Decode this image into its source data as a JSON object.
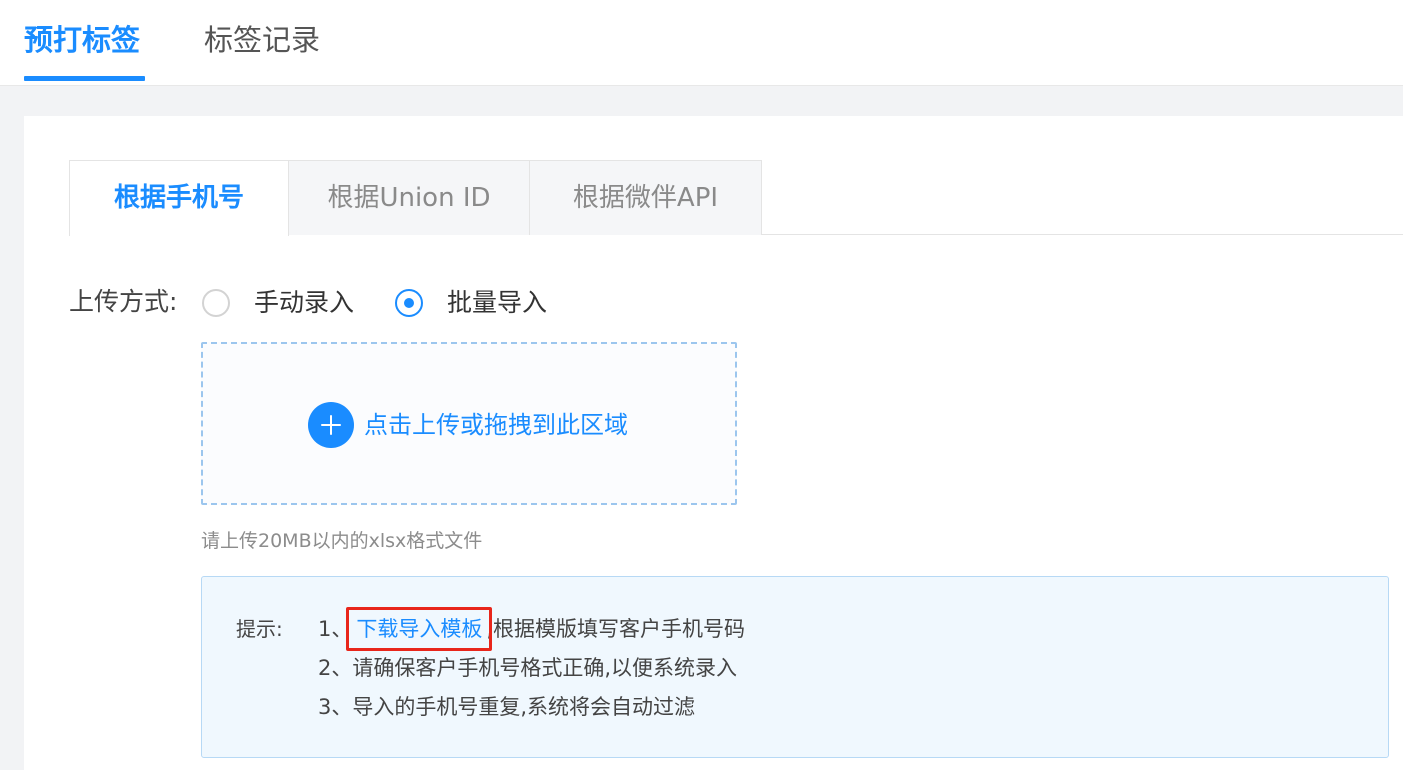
{
  "top_tabs": [
    {
      "label": "预打标签",
      "active": true
    },
    {
      "label": "标签记录",
      "active": false
    }
  ],
  "sub_tabs": [
    {
      "label": "根据手机号",
      "active": true
    },
    {
      "label": "根据Union ID",
      "active": false
    },
    {
      "label": "根据微伴API",
      "active": false
    }
  ],
  "upload": {
    "label": "上传方式:",
    "options": [
      {
        "label": "手动录入",
        "checked": false
      },
      {
        "label": "批量导入",
        "checked": true
      }
    ],
    "dropzone_text": "点击上传或拖拽到此区域",
    "file_hint": "请上传20MB以内的xlsx格式文件"
  },
  "tips": {
    "title": "提示:",
    "line1_prefix": "1、",
    "line1_link": "下载导入模板",
    "line1_suffix": ",根据模版填写客户手机号码",
    "line2": "2、请确保客户手机号格式正确,以便系统录入",
    "line3": "3、导入的手机号重复,系统将会自动过滤"
  },
  "colors": {
    "accent": "#1a8cff",
    "highlight_box": "#e8261b",
    "tips_background": "#f0f8fe"
  },
  "icons": {
    "upload": "plus-circle-icon"
  }
}
